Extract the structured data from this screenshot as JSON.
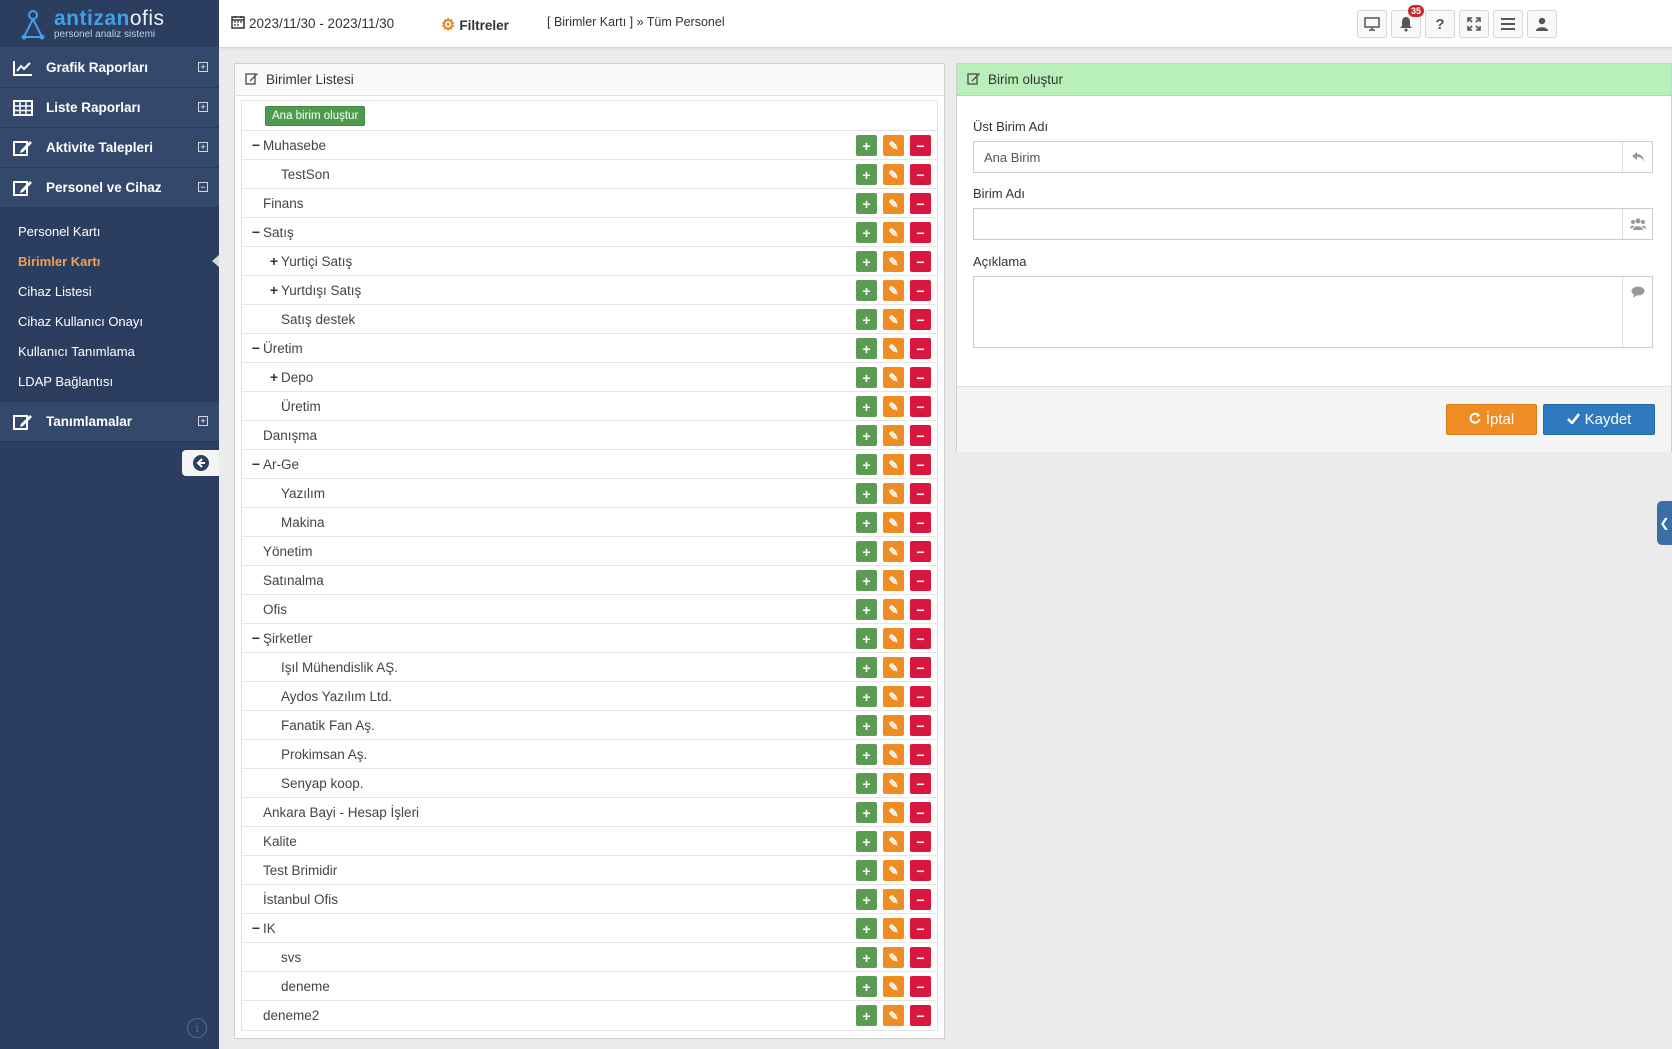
{
  "app": {
    "brand_part1": "antizan",
    "brand_part2": "ofis",
    "brand_sub": "personel analiz sistemi"
  },
  "sidebar": {
    "menu": [
      {
        "label": "Grafik Raporları",
        "icon": "line-chart-icon",
        "toggle": "⊞"
      },
      {
        "label": "Liste Raporları",
        "icon": "table-icon",
        "toggle": "⊞"
      },
      {
        "label": "Aktivite Talepleri",
        "icon": "edit-icon",
        "toggle": "⊞"
      },
      {
        "label": "Personel ve Cihaz",
        "icon": "edit-icon",
        "toggle": "⊟"
      }
    ],
    "submenu": [
      {
        "label": "Personel Kartı"
      },
      {
        "label": "Birimler Kartı"
      },
      {
        "label": "Cihaz Listesi"
      },
      {
        "label": "Cihaz Kullanıcı Onayı"
      },
      {
        "label": "Kullanıcı Tanımlama"
      },
      {
        "label": "LDAP Bağlantısı"
      }
    ],
    "last_menu": {
      "label": "Tanımlamalar",
      "icon": "edit-icon",
      "toggle": "⊞"
    },
    "active_color": "#f0a050"
  },
  "topbar": {
    "date_range": "2023/11/30 - 2023/11/30",
    "filters_label": "Filtreler",
    "breadcrumb": "[ Birimler Kartı ] » Tüm Personel",
    "notification_count": "35"
  },
  "list_panel": {
    "title": "Birimler Listesi",
    "root_button": "Ana birim oluştur",
    "rows": [
      {
        "label": "Muhasebe",
        "level": 0,
        "expander": "−"
      },
      {
        "label": "TestSon",
        "level": 1,
        "expander": ""
      },
      {
        "label": "Finans",
        "level": 0,
        "expander": ""
      },
      {
        "label": "Satış",
        "level": 0,
        "expander": "−"
      },
      {
        "label": "Yurtiçi Satış",
        "level": 1,
        "expander": "+"
      },
      {
        "label": "Yurtdışı Satış",
        "level": 1,
        "expander": "+"
      },
      {
        "label": "Satış destek",
        "level": 1,
        "expander": ""
      },
      {
        "label": "Üretim",
        "level": 0,
        "expander": "−"
      },
      {
        "label": "Depo",
        "level": 1,
        "expander": "+"
      },
      {
        "label": "Üretim",
        "level": 1,
        "expander": ""
      },
      {
        "label": "Danışma",
        "level": 0,
        "expander": ""
      },
      {
        "label": "Ar-Ge",
        "level": 0,
        "expander": "−"
      },
      {
        "label": "Yazılım",
        "level": 1,
        "expander": ""
      },
      {
        "label": "Makina",
        "level": 1,
        "expander": ""
      },
      {
        "label": "Yönetim",
        "level": 0,
        "expander": ""
      },
      {
        "label": "Satınalma",
        "level": 0,
        "expander": ""
      },
      {
        "label": "Ofis",
        "level": 0,
        "expander": ""
      },
      {
        "label": "Şirketler",
        "level": 0,
        "expander": "−"
      },
      {
        "label": "Işıl Mühendislik AŞ.",
        "level": 1,
        "expander": ""
      },
      {
        "label": "Aydos Yazılım Ltd.",
        "level": 1,
        "expander": ""
      },
      {
        "label": "Fanatik Fan Aş.",
        "level": 1,
        "expander": ""
      },
      {
        "label": "Prokimsan Aş.",
        "level": 1,
        "expander": ""
      },
      {
        "label": "Senyap koop.",
        "level": 1,
        "expander": ""
      },
      {
        "label": "Ankara Bayi - Hesap İşleri",
        "level": 0,
        "expander": ""
      },
      {
        "label": "Kalite",
        "level": 0,
        "expander": ""
      },
      {
        "label": "Test Brimidir",
        "level": 0,
        "expander": ""
      },
      {
        "label": "İstanbul Ofis",
        "level": 0,
        "expander": ""
      },
      {
        "label": "IK",
        "level": 0,
        "expander": "−"
      },
      {
        "label": "svs",
        "level": 1,
        "expander": ""
      },
      {
        "label": "deneme",
        "level": 1,
        "expander": ""
      },
      {
        "label": "deneme2",
        "level": 0,
        "expander": ""
      }
    ]
  },
  "form_panel": {
    "title": "Birim oluştur",
    "parent_label": "Üst Birim Adı",
    "parent_value": "Ana Birim",
    "name_label": "Birim Adı",
    "name_value": "",
    "desc_label": "Açıklama",
    "desc_value": "",
    "cancel_label": "İptal",
    "save_label": "Kaydet"
  },
  "colors": {
    "add": "#5c9b54",
    "edit": "#ef8c23",
    "delete": "#d9173e",
    "header_green": "#b9efb9",
    "save": "#2f79bf"
  }
}
